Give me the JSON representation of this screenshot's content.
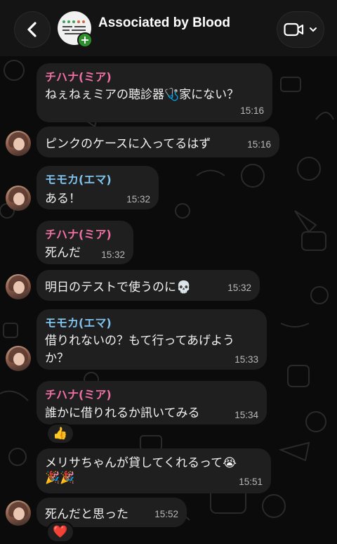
{
  "header": {
    "title": "Associated by Blood",
    "back_icon": "chevron-left-icon",
    "video_icon": "video-camera-icon",
    "add_icon": "add-member-icon"
  },
  "messages": [
    {
      "sender": "チハナ(ミア)",
      "sender_color": "#f06fa3",
      "text": "ねぇねぇミアの聴診器🩺家にない？",
      "time": "15:16"
    },
    {
      "text": "ピンクのケースに入ってるはず",
      "time": "15:16"
    },
    {
      "sender": "モモカ(エマ)",
      "sender_color": "#7fc3ee",
      "text": "ある！",
      "time": "15:32"
    },
    {
      "sender": "チハナ(ミア)",
      "sender_color": "#f06fa3",
      "text": "死んだ",
      "time": "15:32"
    },
    {
      "text": "明日のテストで使うのに💀",
      "time": "15:32"
    },
    {
      "sender": "モモカ(エマ)",
      "sender_color": "#7fc3ee",
      "text_line1": "借りれないの？もて行ってあげよう",
      "text_line2": "か？",
      "time": "15:33"
    },
    {
      "sender": "チハナ(ミア)",
      "sender_color": "#f06fa3",
      "text": "誰かに借りれるか訊いてみる",
      "time": "15:34",
      "reaction": "👍"
    },
    {
      "text_line1": "メリサちゃんが貸してくれるって😭",
      "text_line2": "🎉🎉",
      "time": "15:51"
    },
    {
      "text": "死んだと思った",
      "time": "15:52",
      "reaction": "❤️"
    }
  ]
}
